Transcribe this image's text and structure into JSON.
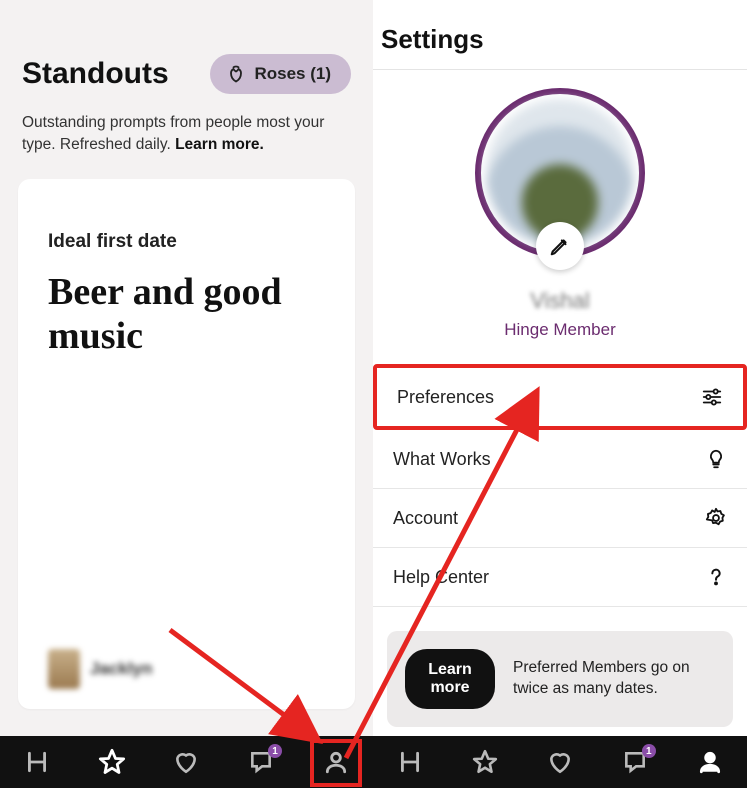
{
  "left": {
    "title": "Standouts",
    "roses_label": "Roses (1)",
    "subtitle_pre": "Outstanding prompts from people most your type. Refreshed daily. ",
    "subtitle_link": "Learn more.",
    "card": {
      "prompt": "Ideal first date",
      "answer": "Beer and good music",
      "user_name": "Jacklyn"
    }
  },
  "right": {
    "title": "Settings",
    "profile_name": "Vishal",
    "member_label": "Hinge Member",
    "menu": {
      "preferences": "Preferences",
      "what_works": "What Works",
      "account": "Account",
      "help_center": "Help Center"
    },
    "promo": {
      "button": "Learn more",
      "text": "Preferred Members go on twice as many dates."
    }
  },
  "nav": {
    "badge_chat": "1"
  }
}
